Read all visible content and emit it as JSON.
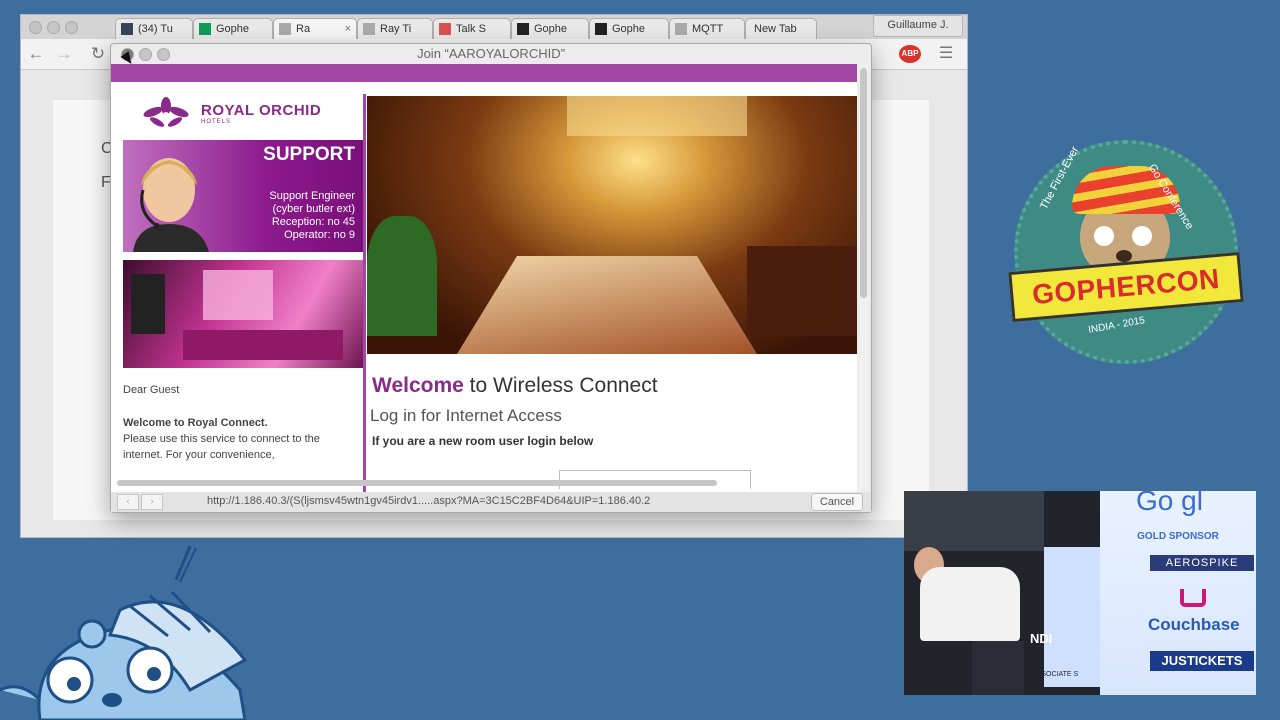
{
  "browser": {
    "tabs": [
      {
        "label": "(34) Tu",
        "icon": "tumblr-icon",
        "icon_color": "#35465c"
      },
      {
        "label": "Gophe",
        "icon": "sheets-icon",
        "icon_color": "#0f9d58"
      },
      {
        "label": "Ra",
        "icon": "doc-icon",
        "icon_color": "#aaaaaa",
        "active": true
      },
      {
        "label": "Ray Ti",
        "icon": "doc-icon",
        "icon_color": "#aaaaaa"
      },
      {
        "label": "Talk S",
        "icon": "talk-icon",
        "icon_color": "#d9534f"
      },
      {
        "label": "Gophe",
        "icon": "asterisk-icon",
        "icon_color": "#222222"
      },
      {
        "label": "Gophe",
        "icon": "asterisk-icon",
        "icon_color": "#222222"
      },
      {
        "label": "MQTT",
        "icon": "doc-icon",
        "icon_color": "#aaaaaa"
      },
      {
        "label": "New Tab",
        "icon": "",
        "icon_color": ""
      }
    ],
    "user_label": "Guillaume J.",
    "adblock_label": "ABP",
    "page_partial": {
      "line1": "C",
      "line2": "F"
    }
  },
  "dialog": {
    "title": "Join “AAROYALORCHID”",
    "status_url": "http://1.186.40.3/(S(ljsmsv45wtn1gv45irdv1.....aspx?MA=3C15C2BF4D64&UIP=1.186.40.2",
    "cancel_label": "Cancel"
  },
  "portal": {
    "brand": "ROYAL ORCHID",
    "brand_sub": "HOTELS",
    "support": {
      "title": "SUPPORT",
      "lines": [
        "Support Engineer",
        "(cyber butler ext)",
        "Reception: no 45",
        "Operator: no 9"
      ]
    },
    "dear_guest": "Dear Guest",
    "welcome_royal": "Welcome to Royal Connect.",
    "para": "Please use this service to connect to the internet. For your convenience,",
    "headline_welcome": "Welcome",
    "headline_rest": " to Wireless Connect",
    "login_heading": "Log in for Internet Access",
    "new_room_user": "If you are a new room user login below",
    "accent_color": "#a248a4"
  },
  "badge": {
    "arc_left": "The First-Ever",
    "arc_right": "Go Conference",
    "name": "GOPHERCON",
    "bottom": "INDIA - 2015",
    "color": "#3e8b86"
  },
  "video": {
    "sponsor_title": "GOLD SPONSOR",
    "google_partial": "Go   gl",
    "sponsors": [
      "AEROSPIKE",
      "Couchbase",
      "JUSTICKETS"
    ],
    "left_partial": "NDI",
    "left_sub": "ASSOCIATE S"
  }
}
